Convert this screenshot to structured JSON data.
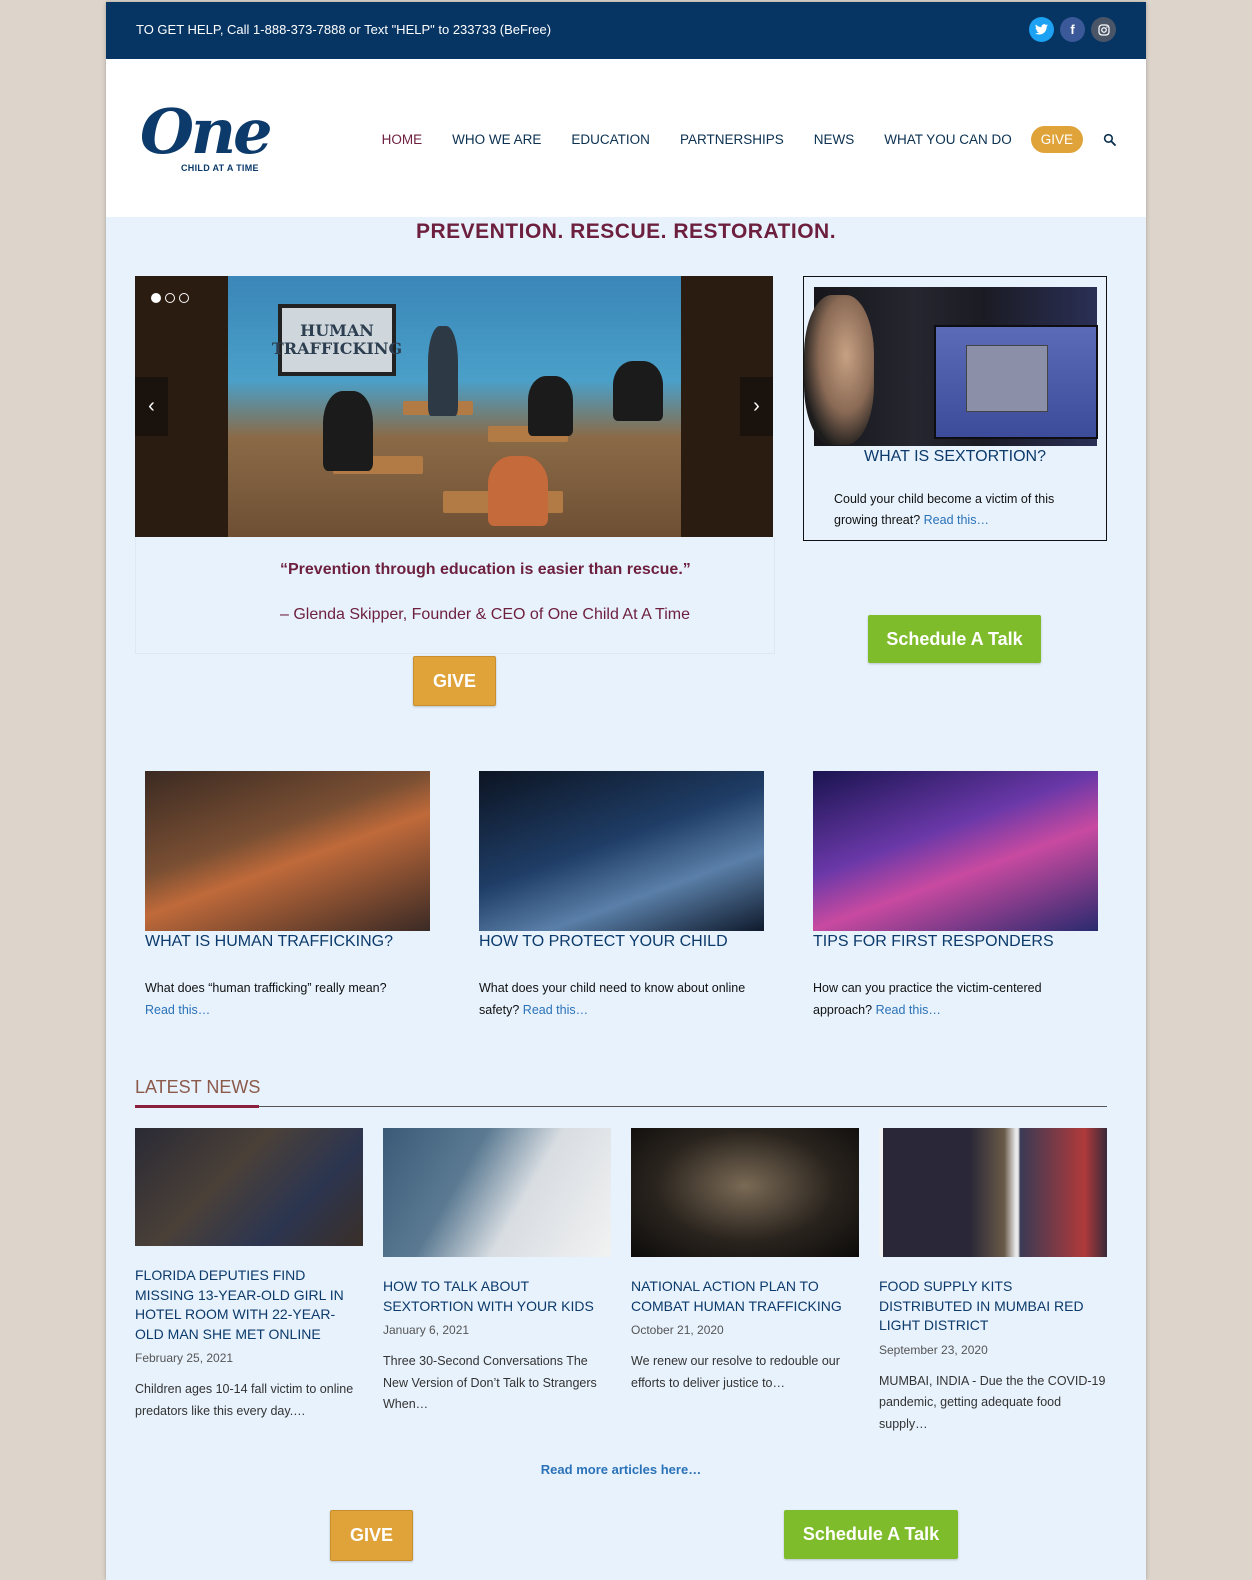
{
  "topbar": {
    "help_text": "TO GET HELP, Call 1-888-373-7888 or Text \"HELP\" to 233733 (BeFree)",
    "social": [
      "twitter-icon",
      "facebook-icon",
      "instagram-icon"
    ]
  },
  "logo": {
    "main": "One",
    "sub": "CHILD AT A TIME"
  },
  "nav": {
    "items": [
      "HOME",
      "WHO WE ARE",
      "EDUCATION",
      "PARTNERSHIPS",
      "NEWS",
      "WHAT YOU CAN DO"
    ],
    "give": "GIVE",
    "search_icon": "search-icon"
  },
  "tagline": "PREVENTION. RESCUE. RESTORATION.",
  "slider": {
    "screen_text": "HUMAN TRAFFICKING",
    "quote": "“Prevention through education is easier than rescue.”",
    "author": "– Glenda Skipper, Founder & CEO of One Child At A Time",
    "prev_icon": "chevron-left-icon",
    "next_icon": "chevron-right-icon"
  },
  "give_button": "GIVE",
  "schedule_button": "Schedule A Talk",
  "sextortion": {
    "title": "WHAT IS SEXTORTION?",
    "text": "Could your child become a victim of this growing threat?",
    "link": "Read this…"
  },
  "features": [
    {
      "title": "WHAT IS HUMAN TRAFFICKING?",
      "text": "What does “human trafficking” really mean?",
      "link": "Read this…"
    },
    {
      "title": "HOW TO PROTECT YOUR CHILD",
      "text": "What does your child need to know about online safety?",
      "link": "Read this…"
    },
    {
      "title": "TIPS FOR FIRST RESPONDERS",
      "text": "How can you practice the victim-centered approach?",
      "link": "Read this…"
    }
  ],
  "latest_news": {
    "heading": "LATEST NEWS",
    "articles": [
      {
        "title": "FLORIDA DEPUTIES FIND MISSING 13-YEAR-OLD GIRL IN HOTEL ROOM WITH 22-YEAR-OLD MAN SHE MET ONLINE",
        "date": "February 25, 2021",
        "excerpt": "Children ages 10-14 fall victim to online predators like this every day.…"
      },
      {
        "title": "HOW TO TALK ABOUT SEXTORTION WITH YOUR KIDS",
        "date": "January 6, 2021",
        "excerpt": "Three 30-Second Conversations The New Version of Don’t Talk to Strangers When…"
      },
      {
        "title": "NATIONAL ACTION PLAN TO COMBAT HUMAN TRAFFICKING",
        "date": "October 21, 2020",
        "excerpt": "We renew our resolve to redouble our efforts to deliver justice to…"
      },
      {
        "title": "FOOD SUPPLY KITS DISTRIBUTED IN MUMBAI RED LIGHT DISTRICT",
        "date": "September 23, 2020",
        "excerpt": "MUMBAI, INDIA - Due the the COVID-19 pandemic, getting adequate food supply…"
      }
    ],
    "read_more": "Read more articles here…"
  },
  "colors": {
    "navy": "#063564",
    "maroon": "#6d1f3e",
    "gold": "#e0a33a",
    "green": "#7fbc2b",
    "link": "#2a72b8"
  }
}
